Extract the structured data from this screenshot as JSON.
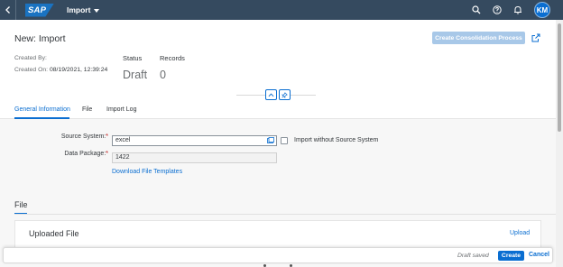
{
  "shell": {
    "logo_text": "SAP",
    "app_title": "Import",
    "avatar_initials": "KM",
    "icons": [
      "back-icon",
      "search-icon",
      "help-icon",
      "notification-icon"
    ]
  },
  "header": {
    "title": "New: Import",
    "consolidation_button": "Create Consolidation Process",
    "created_by_label": "Created By:",
    "created_by_value": "",
    "created_on_label": "Created On:",
    "created_on_value": "08/19/2021, 12:39:24",
    "status_label": "Status",
    "status_value": "Draft",
    "records_label": "Records",
    "records_value": "0"
  },
  "tabs": [
    {
      "label": "General Information",
      "active": true
    },
    {
      "label": "File",
      "active": false
    },
    {
      "label": "Import Log",
      "active": false
    }
  ],
  "form": {
    "source_system_label": "Source System:",
    "source_system_value": "excel",
    "import_without_label": "Import without Source System",
    "data_package_label": "Data Package:",
    "data_package_value": "1422",
    "required_marker": "*",
    "download_link": "Download File Templates"
  },
  "file_section": {
    "title": "File",
    "panel_title": "Uploaded File",
    "upload_link": "Upload"
  },
  "footer": {
    "draft_status": "Draft saved",
    "create_label": "Create",
    "cancel_label": "Cancel"
  },
  "colors": {
    "shell": "#354a5f",
    "accent": "#0a6ed1",
    "required": "#bb0000"
  }
}
